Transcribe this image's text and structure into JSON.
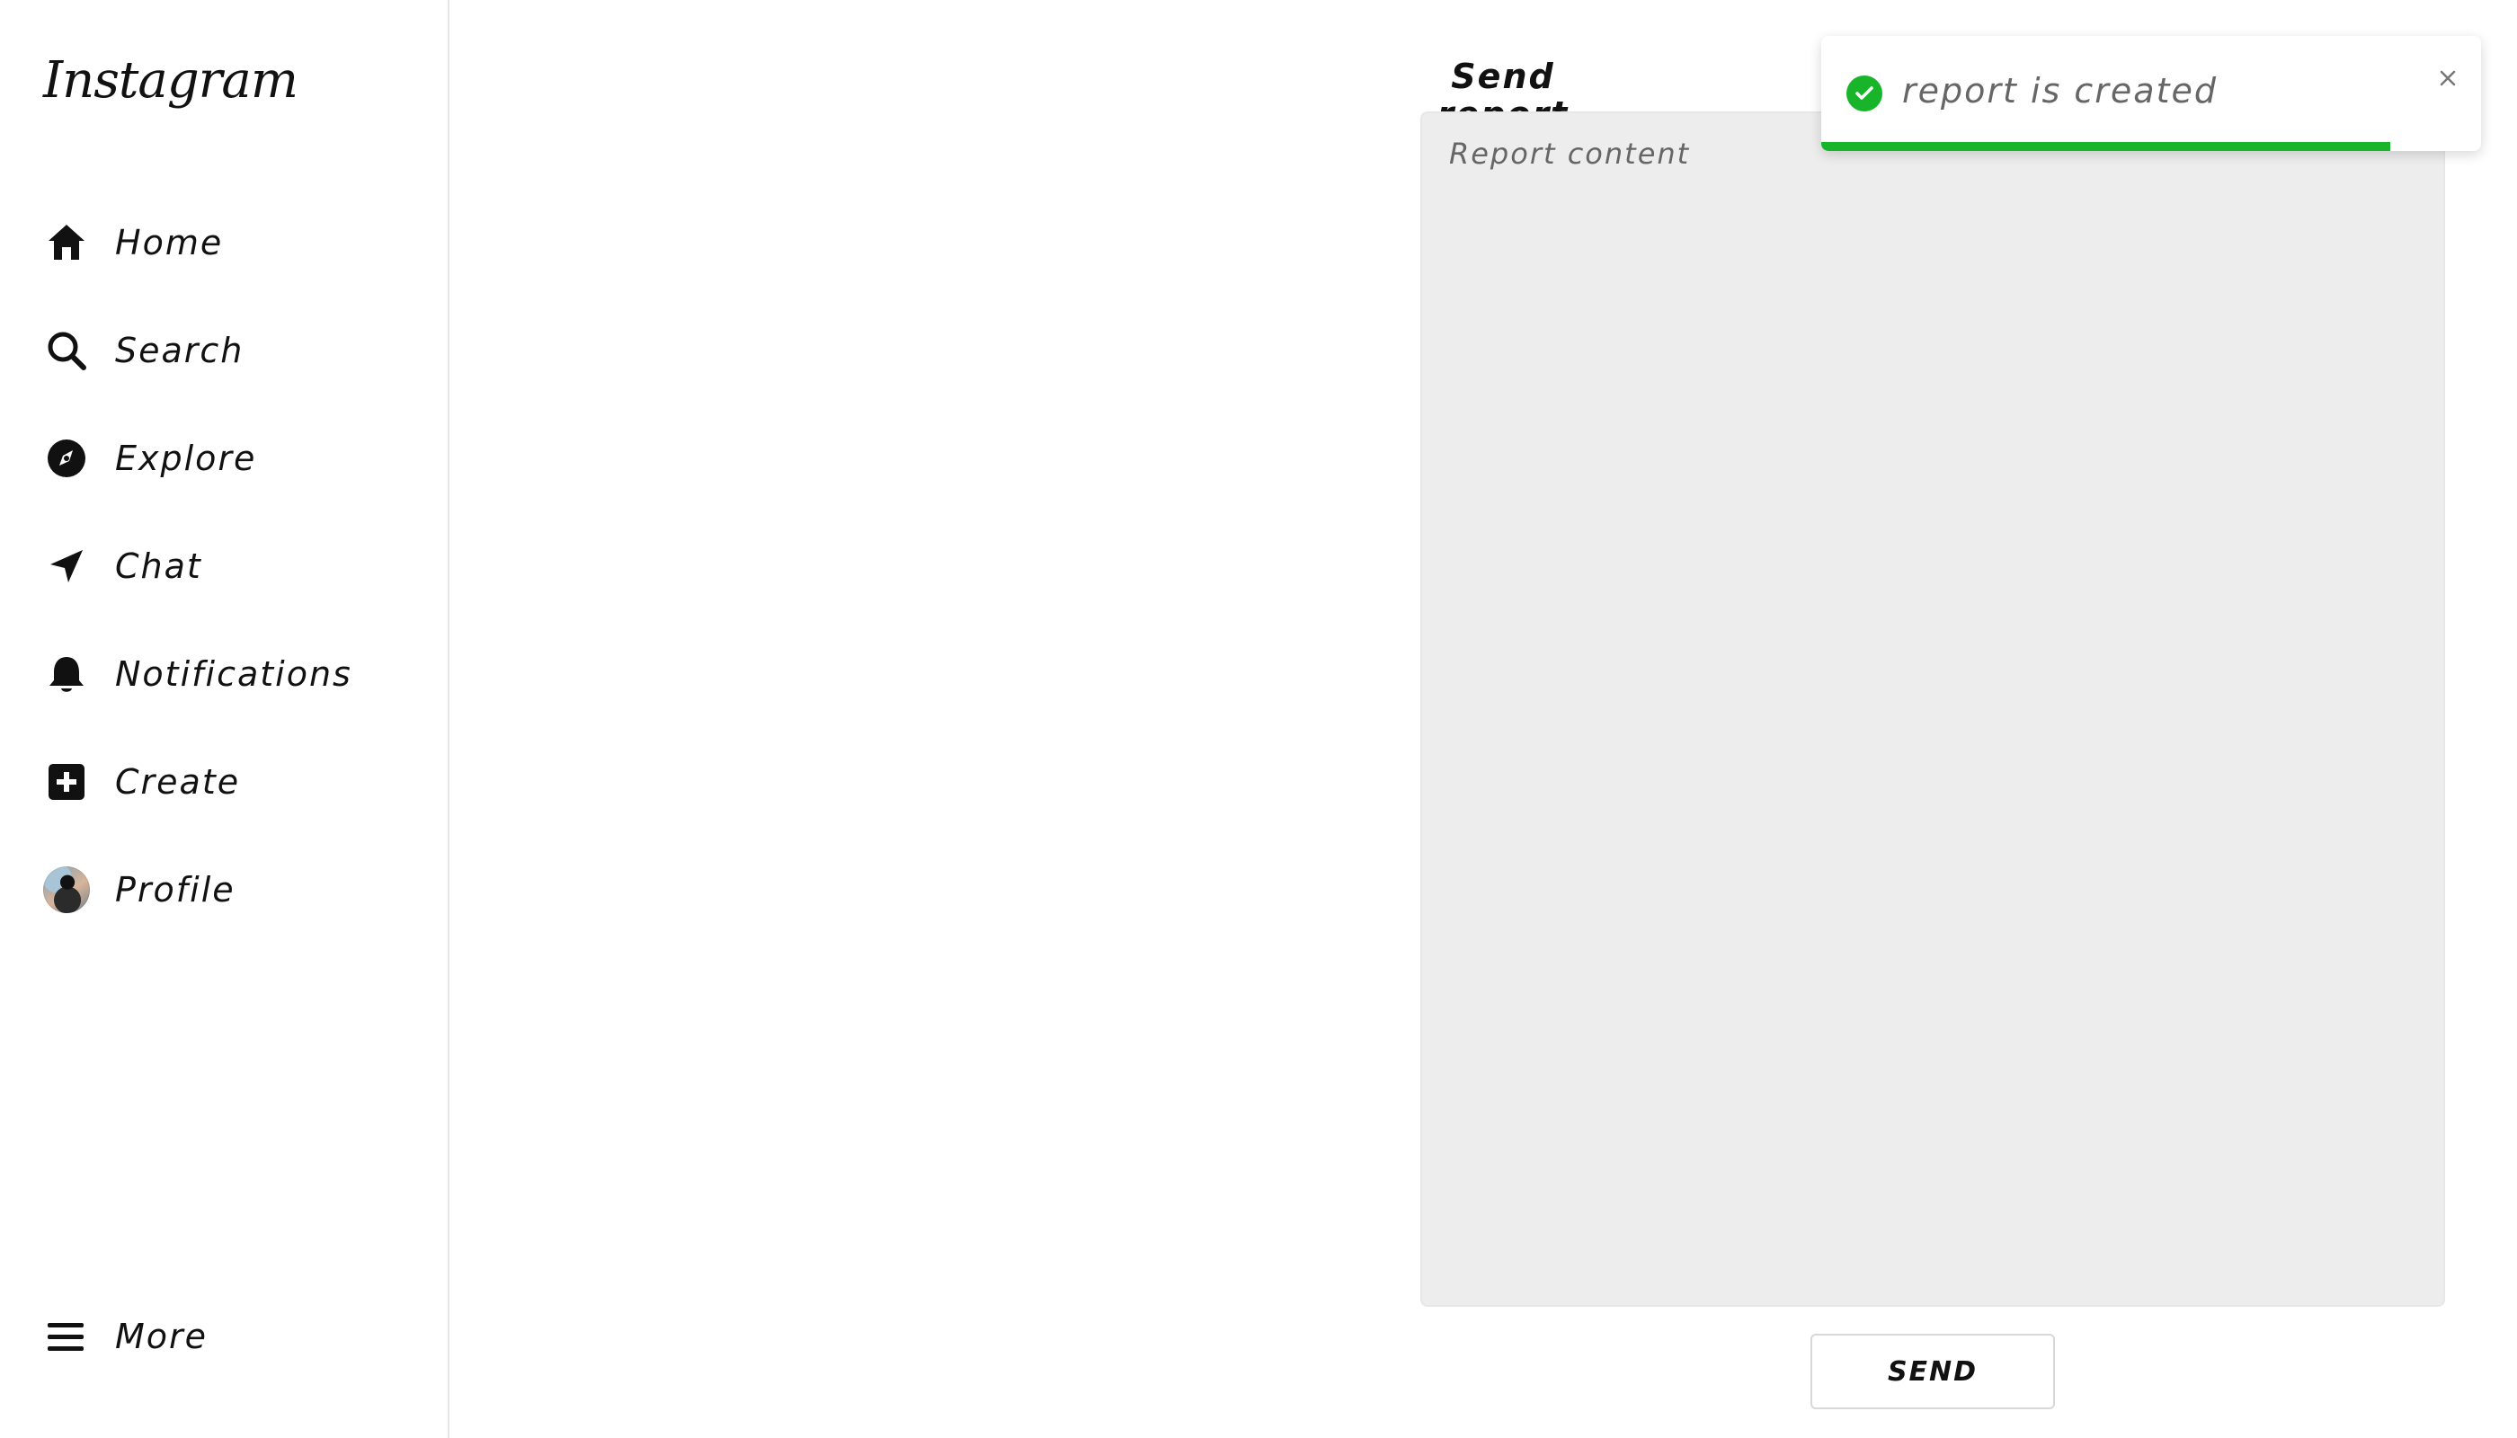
{
  "sidebar": {
    "brand": "Instagram",
    "items": [
      {
        "label": "Home",
        "icon": "home-icon"
      },
      {
        "label": "Search",
        "icon": "search-icon"
      },
      {
        "label": "Explore",
        "icon": "compass-icon"
      },
      {
        "label": "Chat",
        "icon": "send-icon"
      },
      {
        "label": "Notifications",
        "icon": "bell-icon"
      },
      {
        "label": "Create",
        "icon": "plus-square-icon"
      },
      {
        "label": "Profile",
        "icon": "avatar"
      }
    ],
    "more": {
      "label": "More",
      "icon": "menu-icon"
    }
  },
  "main": {
    "title": "Send report",
    "report": {
      "placeholder": "Report content",
      "value": ""
    },
    "send_label": "SEND"
  },
  "toast": {
    "message": "report is created",
    "status": "success",
    "progress_percent": 86.3,
    "colors": {
      "success": "#18b52a"
    }
  }
}
